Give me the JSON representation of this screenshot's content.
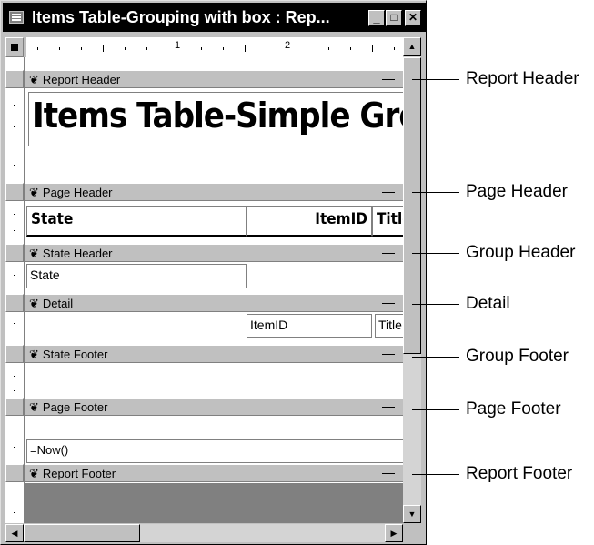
{
  "window": {
    "title": "Items Table-Grouping with box : Rep...",
    "minimize": "_",
    "maximize": "□",
    "close": "✕"
  },
  "ruler": {
    "marks": [
      "1",
      "2"
    ]
  },
  "sections": {
    "report_header": "Report Header",
    "page_header": "Page Header",
    "state_header": "State Header",
    "detail": "Detail",
    "state_footer": "State Footer",
    "page_footer": "Page Footer",
    "report_footer": "Report Footer"
  },
  "controls": {
    "report_title": "Items Table-Simple Group",
    "col_state": "State",
    "col_itemid": "ItemID",
    "col_title": "Title",
    "state_field": "State",
    "itemid_field": "ItemID",
    "title_field": "Title",
    "now_field": "=Now()"
  },
  "callouts": {
    "report_header": "Report Header",
    "page_header": "Page Header",
    "group_header": "Group Header",
    "detail": "Detail",
    "group_footer": "Group Footer",
    "page_footer": "Page Footer",
    "report_footer": "Report Footer"
  },
  "icons": [
    "report-icon",
    "scroll-up-icon",
    "scroll-down-icon",
    "scroll-left-icon",
    "scroll-right-icon"
  ]
}
